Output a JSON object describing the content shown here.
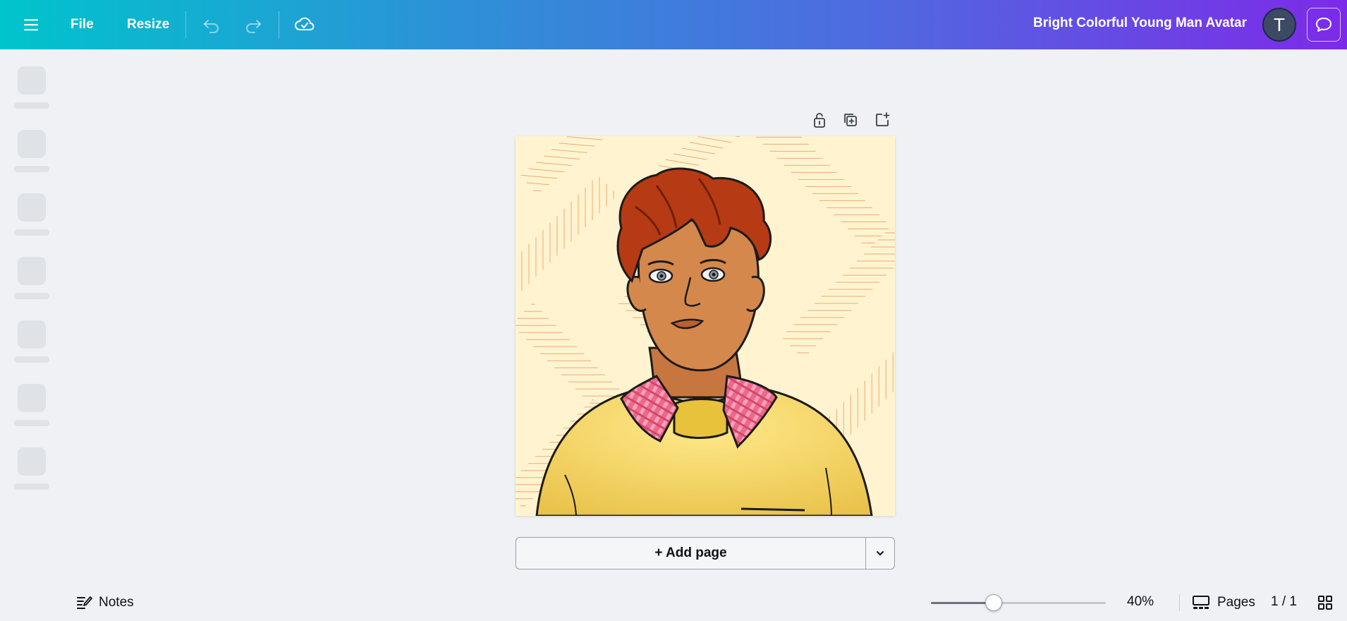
{
  "toolbar": {
    "file_label": "File",
    "resize_label": "Resize",
    "menu_icon": "hamburger-menu-icon",
    "undo_icon": "undo-icon",
    "redo_icon": "redo-icon",
    "save_status_icon": "cloud-check-icon"
  },
  "document": {
    "title": "Bright Colorful Young Man Avatar"
  },
  "user": {
    "avatar_initial": "T"
  },
  "page_tools": {
    "lock_icon": "lock-icon",
    "duplicate_icon": "duplicate-page-icon",
    "add_icon": "add-page-icon"
  },
  "canvas": {
    "artwork": "illustrated avatar of a young man with auburn hair, pink plaid collar and yellow sweater on a cream background with orange crosshatch pattern",
    "background_color": "#fff4cf"
  },
  "add_page": {
    "label": "+ Add page"
  },
  "footer": {
    "notes_label": "Notes",
    "zoom_value": "40%",
    "zoom_level": 0.36,
    "pages_label": "Pages",
    "page_count": "1 / 1"
  },
  "colors": {
    "gradient_start": "#00c4cc",
    "gradient_end": "#7d2ae8"
  }
}
